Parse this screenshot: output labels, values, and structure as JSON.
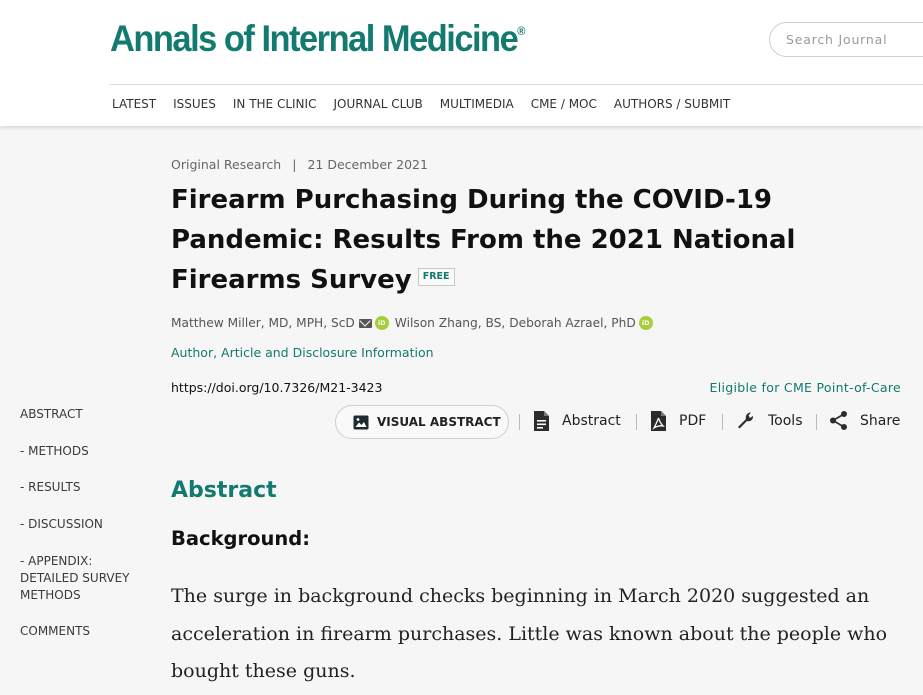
{
  "header": {
    "logo": "Annals of Internal Medicine",
    "logo_mark": "®",
    "search_placeholder": "Search Journal"
  },
  "nav": [
    "LATEST",
    "ISSUES",
    "IN THE CLINIC",
    "JOURNAL CLUB",
    "MULTIMEDIA",
    "CME / MOC",
    "AUTHORS / SUBMIT"
  ],
  "sidebar": {
    "items": [
      {
        "label": "ABSTRACT"
      },
      {
        "label": "- METHODS"
      },
      {
        "label": "- RESULTS"
      },
      {
        "label": "- DISCUSSION"
      },
      {
        "label": "- APPENDIX: DETAILED SURVEY METHODS"
      },
      {
        "label": "COMMENTS"
      }
    ]
  },
  "article": {
    "type": "Original Research",
    "separator": "|",
    "date": "21 December 2021",
    "title": "Firearm Purchasing During the COVID-19 Pandemic: Results From the 2021 National Firearms Survey",
    "free_badge": "FREE",
    "authors": [
      {
        "name": "Matthew Miller, MD, MPH, ScD"
      },
      {
        "name": "Wilson Zhang, BS,"
      },
      {
        "name": "Deborah Azrael, PhD"
      }
    ],
    "orcid_label": "iD",
    "author_info_link": "Author, Article and Disclosure Information",
    "doi": "https://doi.org/10.7326/M21-3423",
    "cme": "Eligible for CME Point-of-Care"
  },
  "toolbar": {
    "visual_abstract": "VISUAL ABSTRACT",
    "abstract": "Abstract",
    "pdf": "PDF",
    "tools": "Tools",
    "share": "Share"
  },
  "abstract": {
    "heading": "Abstract",
    "background_heading": "Background:",
    "background_text": "The surge in background checks beginning in March 2020 suggested an acceleration in firearm purchases. Little was known about the people who bought these guns."
  },
  "colors": {
    "brand": "#127a6f",
    "orcid": "#a6ce39"
  }
}
